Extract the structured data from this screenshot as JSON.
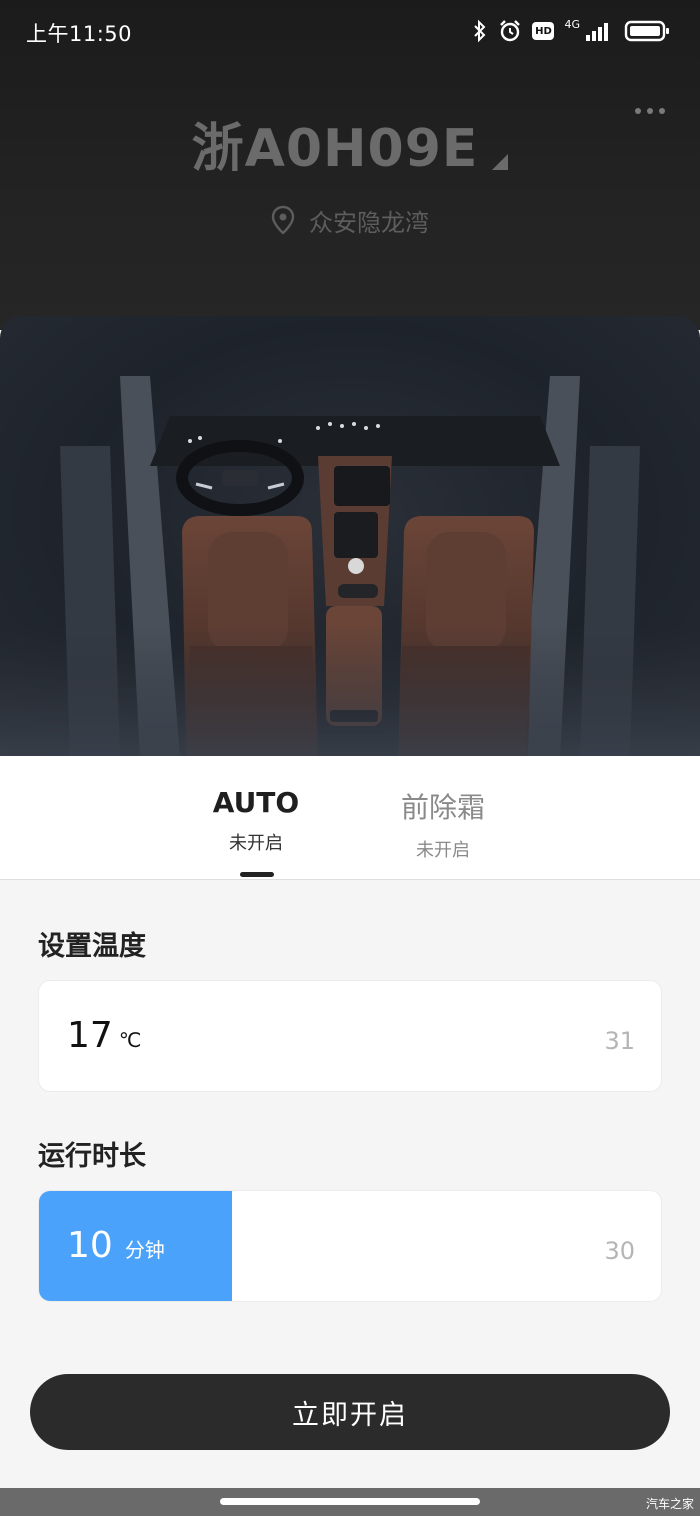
{
  "status_bar": {
    "time": "上午11:50",
    "network": "4G",
    "hd_badge": "HD",
    "icons": [
      "bluetooth-icon",
      "alarm-icon",
      "hd-icon",
      "signal-icon",
      "battery-icon"
    ]
  },
  "vehicle": {
    "plate": "浙A0H09E",
    "location": "众安隐龙湾"
  },
  "tabs": [
    {
      "title": "AUTO",
      "status": "未开启",
      "active": true
    },
    {
      "title": "前除霜",
      "status": "未开启",
      "active": false
    }
  ],
  "temperature": {
    "label": "设置温度",
    "value": "17",
    "unit": "℃",
    "max": "31"
  },
  "duration": {
    "label": "运行时长",
    "value": "10",
    "unit": "分钟",
    "max": "30",
    "level": 0.31
  },
  "start_button_label": "立即开启",
  "watermark": "汽车之家",
  "colors": {
    "accent": "#4aa2fb",
    "dark_button": "#2b2b2b",
    "seat_brown": "#5e3d33"
  }
}
